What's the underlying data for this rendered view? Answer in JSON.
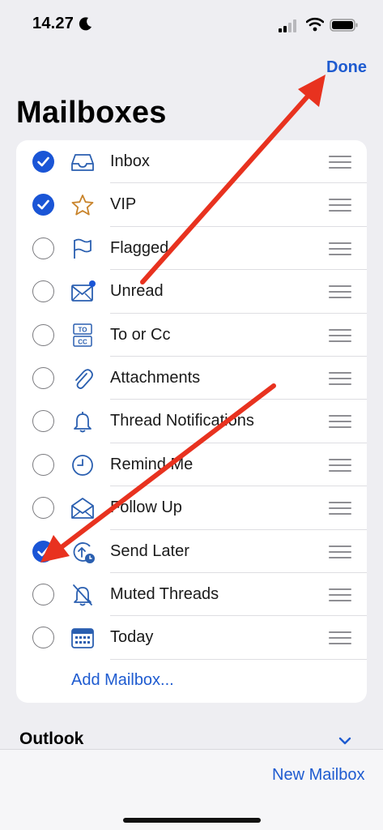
{
  "status": {
    "time": "14.27"
  },
  "header": {
    "done_label": "Done",
    "title": "Mailboxes"
  },
  "mailboxes": [
    {
      "label": "Inbox",
      "checked": true,
      "icon": "inbox-icon"
    },
    {
      "label": "VIP",
      "checked": true,
      "icon": "star-icon"
    },
    {
      "label": "Flagged",
      "checked": false,
      "icon": "flag-icon"
    },
    {
      "label": "Unread",
      "checked": false,
      "icon": "envelope-unread-icon"
    },
    {
      "label": "To or Cc",
      "checked": false,
      "icon": "to-cc-icon"
    },
    {
      "label": "Attachments",
      "checked": false,
      "icon": "paperclip-icon"
    },
    {
      "label": "Thread Notifications",
      "checked": false,
      "icon": "bell-icon"
    },
    {
      "label": "Remind Me",
      "checked": false,
      "icon": "clock-icon"
    },
    {
      "label": "Follow Up",
      "checked": false,
      "icon": "envelope-open-icon"
    },
    {
      "label": "Send Later",
      "checked": true,
      "icon": "send-later-icon"
    },
    {
      "label": "Muted Threads",
      "checked": false,
      "icon": "bell-slash-icon"
    },
    {
      "label": "Today",
      "checked": false,
      "icon": "calendar-icon"
    }
  ],
  "add_mailbox_label": "Add Mailbox...",
  "sections": {
    "outlook_label": "Outlook"
  },
  "toolbar": {
    "new_mailbox_label": "New Mailbox"
  },
  "colors": {
    "accent": "#1e5bd0",
    "check": "#1a55d6",
    "icon": "#2a5fb0",
    "star": "#c8832a",
    "arrow": "#e8321f"
  }
}
